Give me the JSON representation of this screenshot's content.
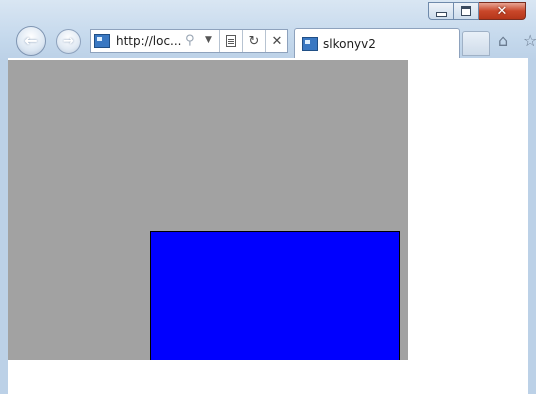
{
  "address_bar": {
    "url": "http://loc..."
  },
  "tab": {
    "title": "slkonyv2"
  },
  "window_controls": {
    "close": "✕"
  },
  "icons": {
    "back": "back-arrow-icon",
    "forward": "forward-arrow-icon",
    "search": "search-icon",
    "dropdown": "chevron-down-icon",
    "compatibility": "compatibility-view-icon",
    "refresh": "refresh-icon",
    "stop": "stop-icon",
    "home": "home-icon"
  },
  "colors": {
    "canvas_gray": "#a2a2a2",
    "rectangle_blue": "#0000ff",
    "close_button": "#c9472a"
  }
}
